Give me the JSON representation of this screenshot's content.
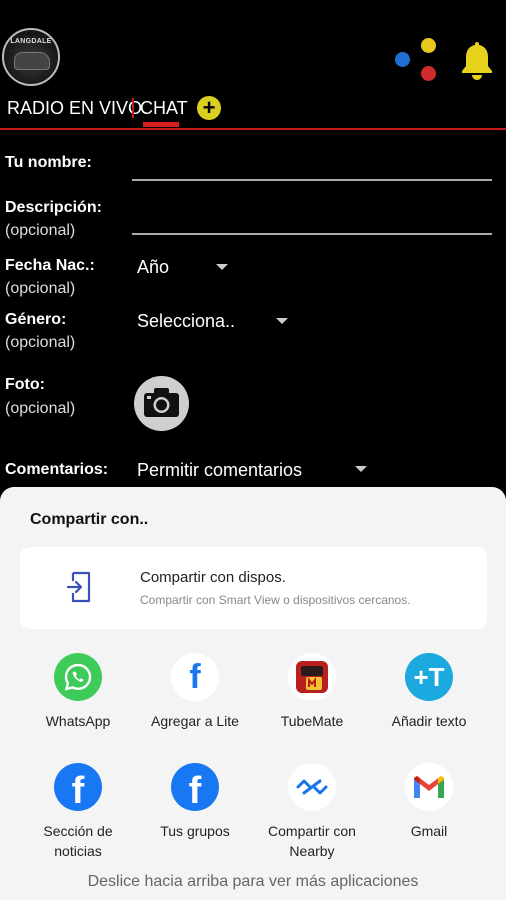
{
  "header": {
    "logo_text": "LANGDALE",
    "colors": {
      "blue": "#1f6fd1",
      "yellow": "#e6c81f",
      "red": "#d12a2a",
      "bell": "#e6d21a"
    }
  },
  "tabs": {
    "radio_label": "RADIO EN VIVO",
    "chat_label": "CHAT",
    "add_symbol": "+"
  },
  "form": {
    "name_label": "Tu nombre:",
    "description_label": "Descripción:",
    "description_optional": "(opcional)",
    "birth_label": "Fecha Nac.:",
    "birth_optional": "(opcional)",
    "birth_value": "Año",
    "gender_label": "Género:",
    "gender_optional": "(opcional)",
    "gender_value": "Selecciona..",
    "photo_label": "Foto:",
    "photo_optional": "(opcional)",
    "comments_label": "Comentarios:",
    "comments_value": "Permitir comentarios"
  },
  "share_sheet": {
    "title": "Compartir con..",
    "nearby_title": "Compartir con dispos.",
    "nearby_subtitle": "Compartir con Smart View o dispositivos cercanos.",
    "apps": [
      {
        "label": "WhatsApp",
        "icon": "whatsapp-icon"
      },
      {
        "label": "Agregar a Lite",
        "icon": "facebook-lite-icon"
      },
      {
        "label": "TubeMate",
        "icon": "tubemate-icon"
      },
      {
        "label": "Añadir texto",
        "icon": "add-text-icon"
      },
      {
        "label": "Sección de noticias",
        "icon": "facebook-icon"
      },
      {
        "label": "Tus grupos",
        "icon": "facebook-icon"
      },
      {
        "label": "Compartir con Nearby",
        "icon": "nearby-share-icon"
      },
      {
        "label": "Gmail",
        "icon": "gmail-icon"
      }
    ],
    "hint": "Deslice hacia arriba para ver más aplicaciones"
  }
}
